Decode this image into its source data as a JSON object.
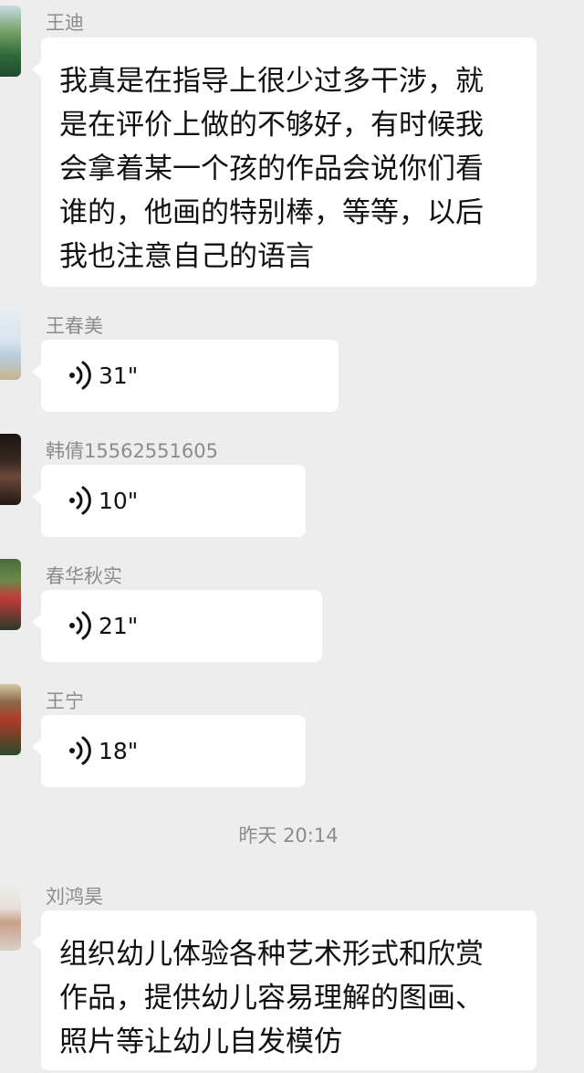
{
  "messages": [
    {
      "sender": "王迪",
      "type": "text",
      "lines": [
        "我真是在指导上很少过多干涉，就",
        "是在评价上做的不够好，有时候我",
        "会拿着某一个孩的作品会说你们看",
        "谁的，他画的特别棒，等等，以后",
        "我也注意自己的语言"
      ]
    },
    {
      "sender": "王春美",
      "type": "voice",
      "duration": "31\""
    },
    {
      "sender": "韩倩15562551605",
      "type": "voice",
      "duration": "10\""
    },
    {
      "sender": "春华秋实",
      "type": "voice",
      "duration": "21\""
    },
    {
      "sender": "王宁",
      "type": "voice",
      "duration": "18\""
    },
    {
      "sender": "刘鸿昊",
      "type": "text",
      "lines": [
        "组织幼儿体验各种艺术形式和欣赏",
        "作品，提供幼儿容易理解的图画、",
        "照片等让幼儿自发模仿"
      ]
    }
  ],
  "timestamp": "昨天 20:14",
  "colors": {
    "background": "#ededed",
    "bubble": "#ffffff",
    "meta_text": "#8c8c8c",
    "message_text": "#111111"
  },
  "icons": {
    "voice": "voice-wave-icon"
  }
}
